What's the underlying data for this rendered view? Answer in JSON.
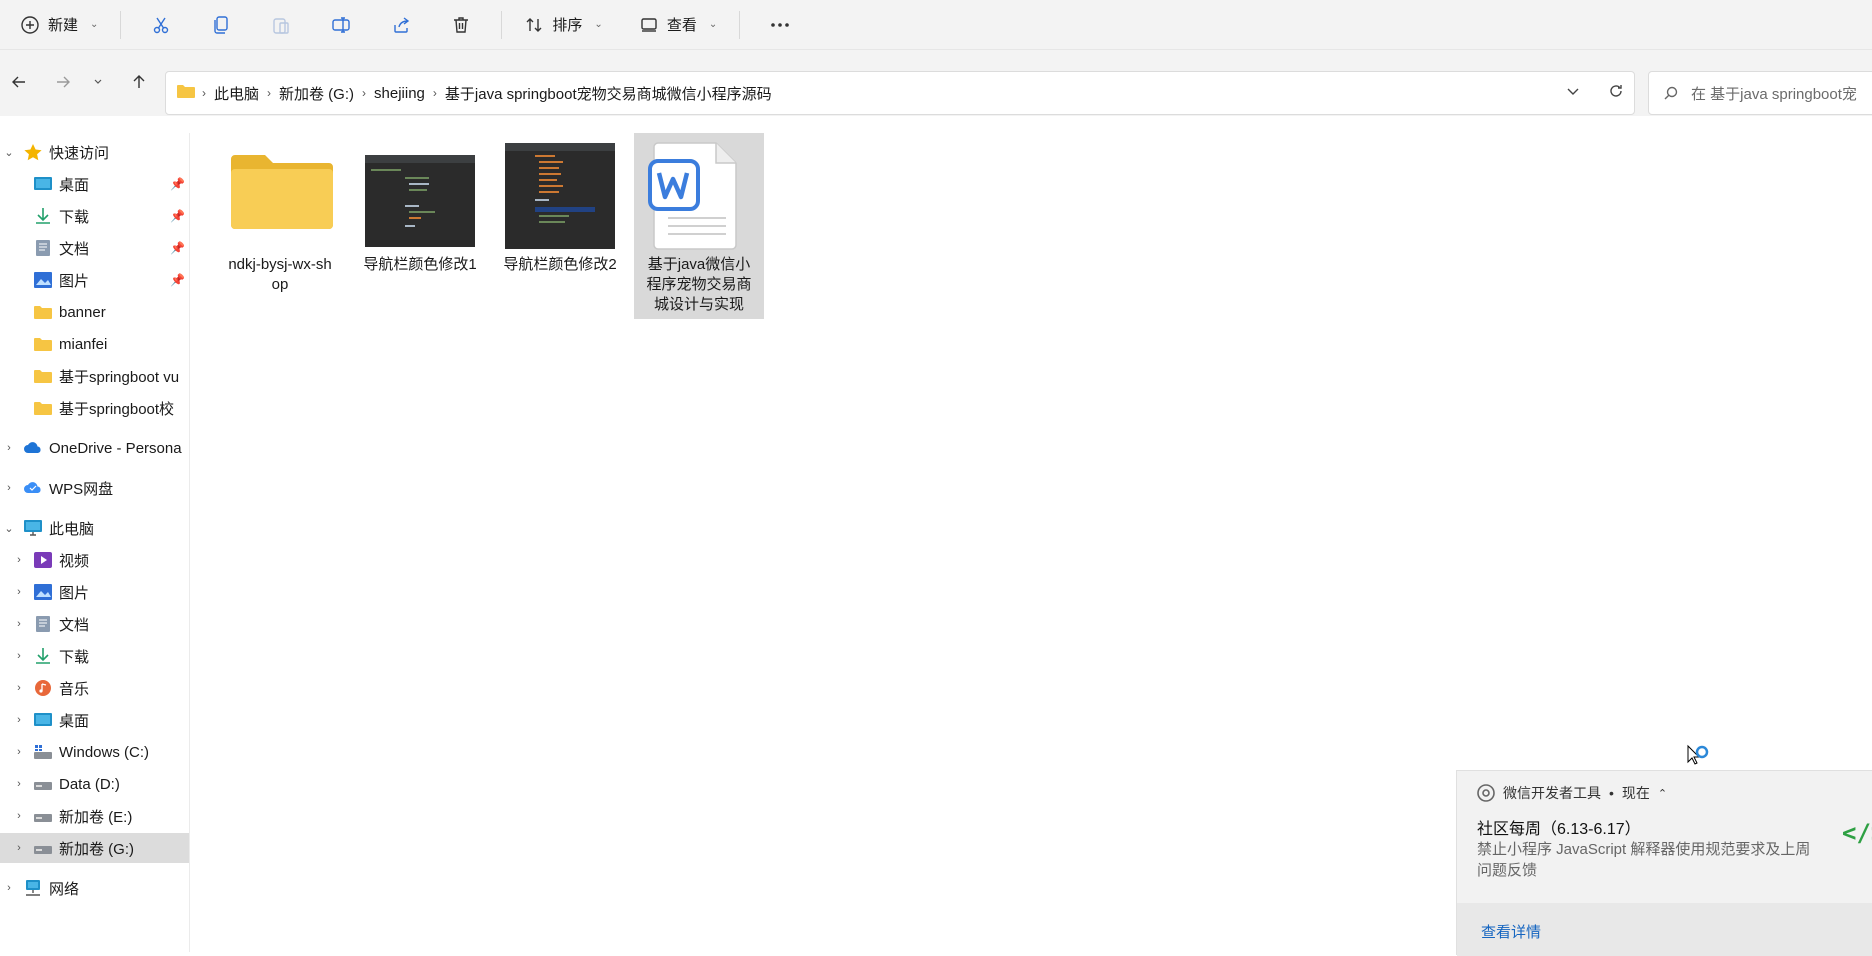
{
  "toolbar": {
    "new_label": "新建",
    "sort_label": "排序",
    "view_label": "查看",
    "icons": [
      "new-icon",
      "cut-icon",
      "copy-icon",
      "paste-icon",
      "rename-icon",
      "share-icon",
      "delete-icon",
      "sort-icon",
      "view-icon",
      "more-icon"
    ]
  },
  "breadcrumb": {
    "items": [
      "此电脑",
      "新加卷 (G:)",
      "shejiing",
      "基于java springboot宠物交易商城微信小程序源码"
    ]
  },
  "search": {
    "placeholder": "在 基于java springboot宠"
  },
  "sidebar": {
    "quick_access": "快速访问",
    "quick_items": [
      "桌面",
      "下载",
      "文档",
      "图片",
      "banner",
      "mianfei",
      "基于springboot vu",
      "基于springboot校"
    ],
    "onedrive": "OneDrive - Persona",
    "wps": "WPS网盘",
    "this_pc": "此电脑",
    "pc_items": [
      "视频",
      "图片",
      "文档",
      "下载",
      "音乐",
      "桌面",
      "Windows (C:)",
      "Data (D:)",
      "新加卷 (E:)",
      "新加卷 (G:)"
    ],
    "network": "网络"
  },
  "files": [
    {
      "name": "ndkj-bysj-wx-sh op",
      "line1": "ndkj-bysj-wx-sh",
      "line2": "op",
      "type": "folder"
    },
    {
      "name": "导航栏颜色修改1",
      "type": "image"
    },
    {
      "name": "导航栏颜色修改2",
      "type": "image"
    },
    {
      "name": "基于java微信小程序宠物交易商城设计与实现",
      "line1": "基于java微信小",
      "line2": "程序宠物交易商",
      "line3": "城设计与实现",
      "type": "wps-doc",
      "selected": true
    }
  ],
  "notification": {
    "app": "微信开发者工具",
    "time": "现在",
    "title": "社区每周（6.13-6.17）",
    "body": "禁止小程序 JavaScript 解释器使用规范要求及上周问题反馈",
    "link": "查看详情"
  },
  "colors": {
    "toolbar_bg": "#f3f3f3",
    "selected_bg": "#d9d9d9",
    "folder": "#f6c543",
    "wps_blue": "#3b7ddd",
    "link": "#1565c0",
    "accent_green": "#2ea043"
  }
}
